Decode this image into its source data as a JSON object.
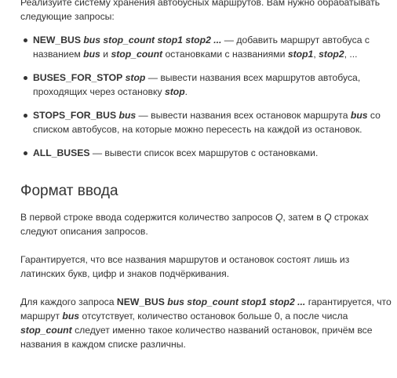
{
  "intro": {
    "line": "Реализуйте систему хранения автобусных маршрутов. Вам нужно обрабатывать следующие запросы:"
  },
  "requests": [
    {
      "keyword": "NEW_BUS",
      "args": "bus stop_count stop1 stop2 ...",
      "t1": " — добавить маршрут автобуса с названием ",
      "a1": "bus",
      "t2": " и ",
      "a2": "stop_count",
      "t3": " остановками с названиями ",
      "a3": "stop1",
      "t4": ", ",
      "a4": "stop2",
      "t5": ", ..."
    },
    {
      "keyword": "BUSES_FOR_STOP",
      "args": "stop",
      "t1": " — вывести названия всех маршрутов автобуса, проходящих через остановку ",
      "a1": "stop",
      "t2": "."
    },
    {
      "keyword": "STOPS_FOR_BUS",
      "args": "bus",
      "t1": " — вывести названия всех остановок маршрута ",
      "a1": "bus",
      "t2": " со списком автобусов, на которые можно пересесть на каждой из остановок."
    },
    {
      "keyword": "ALL_BUSES",
      "t1": " — вывести список всех маршрутов с остановками."
    }
  ],
  "input_format": {
    "heading": "Формат ввода",
    "p1": {
      "t1": "В первой строке ввода содержится количество запросов ",
      "q1": "Q",
      "t2": ", затем в ",
      "q2": "Q",
      "t3": " строках следуют описания запросов."
    },
    "p2": "Гарантируется, что все названия маршрутов и остановок состоят лишь из латинских букв, цифр и знаков подчёркивания.",
    "p3": {
      "t1": "Для каждого запроса ",
      "keyword": "NEW_BUS",
      "args": "bus stop_count stop1 stop2 ...",
      "t2": " гарантируется, что маршрут ",
      "a1": "bus",
      "t3": " отсутствует, количество остановок больше 0, а после числа ",
      "a2": "stop_count",
      "t4": " следует именно такое количество названий остановок, причём все названия в каждом списке различны."
    }
  }
}
